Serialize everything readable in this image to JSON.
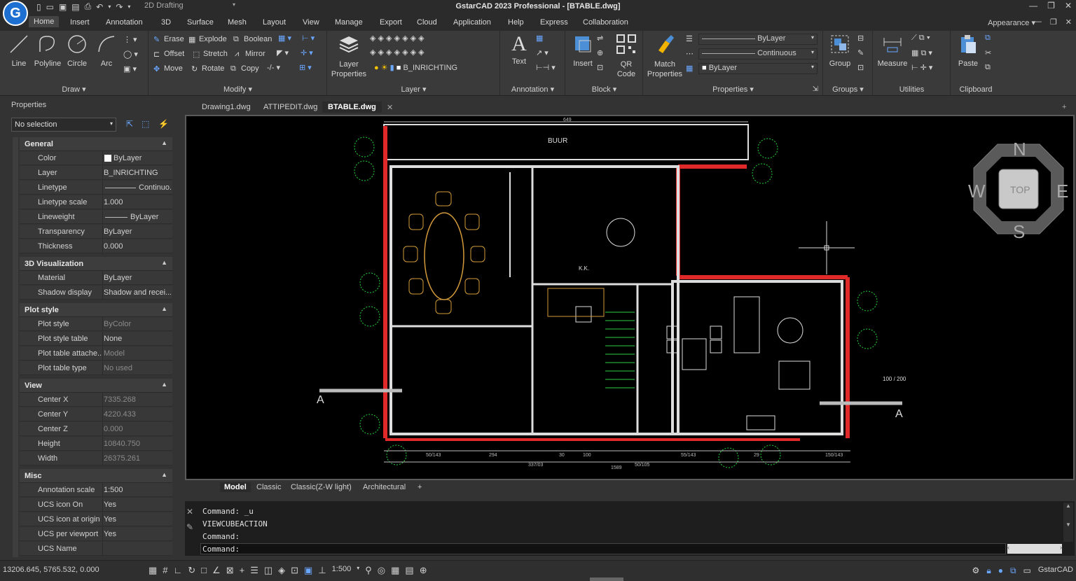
{
  "app": {
    "title": "GstarCAD 2023 Professional - [BTABLE.dwg]",
    "logo_letter": "G",
    "workspace": "2D Drafting",
    "appearance": "Appearance"
  },
  "menu_tabs": [
    "Home",
    "Insert",
    "Annotation",
    "3D",
    "Surface",
    "Mesh",
    "Layout",
    "View",
    "Manage",
    "Export",
    "Cloud",
    "Application",
    "Help",
    "Express",
    "Collaboration"
  ],
  "ribbon": {
    "draw": {
      "label": "Draw",
      "line": "Line",
      "polyline": "Polyline",
      "circle": "Circle",
      "arc": "Arc"
    },
    "modify": {
      "label": "Modify",
      "erase": "Erase",
      "explode": "Explode",
      "boolean": "Boolean",
      "offset": "Offset",
      "stretch": "Stretch",
      "mirror": "Mirror",
      "move": "Move",
      "rotate": "Rotate",
      "copy": "Copy"
    },
    "layer": {
      "label": "Layer",
      "layer_properties": "Layer Properties",
      "current_layer": "B_INRICHTING"
    },
    "annotation": {
      "label": "Annotation",
      "text": "Text"
    },
    "block": {
      "label": "Block",
      "insert": "Insert",
      "qr_code": "QR Code"
    },
    "properties": {
      "label": "Properties",
      "match_properties": "Match Properties",
      "color": "ByLayer",
      "linetype": "Continuous",
      "lineweight": "ByLayer"
    },
    "groups": {
      "label": "Groups",
      "group": "Group"
    },
    "utilities": {
      "label": "Utilities",
      "measure": "Measure"
    },
    "clipboard": {
      "label": "Clipboard",
      "paste": "Paste"
    }
  },
  "properties_panel": {
    "title": "Properties",
    "selection": "No selection",
    "sections": {
      "general": {
        "label": "General",
        "rows": [
          {
            "k": "Color",
            "v": "ByLayer"
          },
          {
            "k": "Layer",
            "v": "B_INRICHTING"
          },
          {
            "k": "Linetype",
            "v": "Continuo..."
          },
          {
            "k": "Linetype scale",
            "v": "1.000"
          },
          {
            "k": "Lineweight",
            "v": "ByLayer"
          },
          {
            "k": "Transparency",
            "v": "ByLayer"
          },
          {
            "k": "Thickness",
            "v": "0.000"
          }
        ]
      },
      "vis3d": {
        "label": "3D Visualization",
        "rows": [
          {
            "k": "Material",
            "v": "ByLayer"
          },
          {
            "k": "Shadow display",
            "v": "Shadow and recei..."
          }
        ]
      },
      "plot": {
        "label": "Plot style",
        "rows": [
          {
            "k": "Plot style",
            "v": "ByColor"
          },
          {
            "k": "Plot style table",
            "v": "None"
          },
          {
            "k": "Plot table attache...",
            "v": "Model"
          },
          {
            "k": "Plot table type",
            "v": "No used"
          }
        ]
      },
      "view": {
        "label": "View",
        "rows": [
          {
            "k": "Center X",
            "v": "7335.268"
          },
          {
            "k": "Center Y",
            "v": "4220.433"
          },
          {
            "k": "Center Z",
            "v": "0.000"
          },
          {
            "k": "Height",
            "v": "10840.750"
          },
          {
            "k": "Width",
            "v": "26375.261"
          }
        ]
      },
      "misc": {
        "label": "Misc",
        "rows": [
          {
            "k": "Annotation scale",
            "v": "1:500"
          },
          {
            "k": "UCS icon On",
            "v": "Yes"
          },
          {
            "k": "UCS icon at origin",
            "v": "Yes"
          },
          {
            "k": "UCS per viewport",
            "v": "Yes"
          },
          {
            "k": "UCS Name",
            "v": ""
          }
        ]
      }
    }
  },
  "document_tabs": [
    "Drawing1.dwg",
    "ATTIPEDIT.dwg",
    "BTABLE.dwg"
  ],
  "layout_tabs": [
    "Model",
    "Classic",
    "Classic(Z-W light)",
    "Architectural",
    "+"
  ],
  "drawing": {
    "top_label": "BUUR",
    "section_marker": "A",
    "viewcube": {
      "top": "TOP",
      "n": "N",
      "s": "S",
      "e": "E",
      "w": "W"
    },
    "dim_top": "649",
    "dims_bottom": [
      "50/143",
      "294",
      "30",
      "100",
      "55/143",
      "29",
      "150/143"
    ],
    "dims_bottom2": [
      "337/03",
      "50/105",
      "1589"
    ],
    "right_dim": "100 / 200",
    "kk": "K.K."
  },
  "command": {
    "lines": [
      "Command: _u",
      "VIEWCUBEACTION",
      "Command:",
      "Command:"
    ]
  },
  "status": {
    "coords": "13206.645, 5765.532, 0.000",
    "scale": "1:500",
    "product": "GstarCAD"
  }
}
